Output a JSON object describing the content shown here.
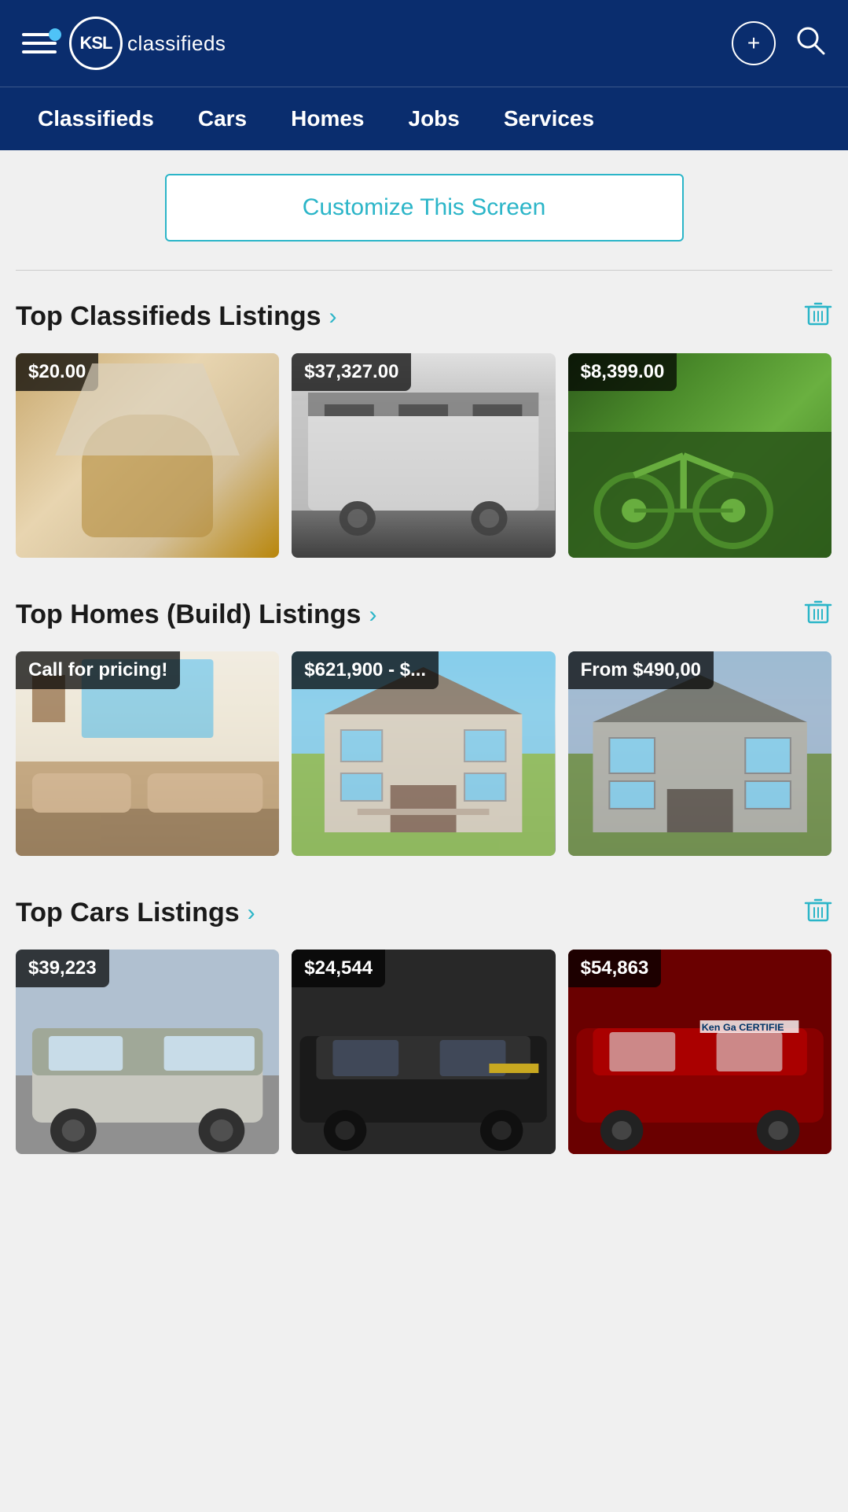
{
  "app": {
    "name": "KSL Classifieds",
    "logo_text": "KSL",
    "logo_sub": "classifieds"
  },
  "nav": {
    "items": [
      {
        "id": "classifieds",
        "label": "Classifieds"
      },
      {
        "id": "cars",
        "label": "Cars"
      },
      {
        "id": "homes",
        "label": "Homes"
      },
      {
        "id": "jobs",
        "label": "Jobs"
      },
      {
        "id": "services",
        "label": "Services"
      }
    ]
  },
  "customize_button": "Customize This Screen",
  "sections": [
    {
      "id": "top-classifieds",
      "title": "Top Classifieds Listings",
      "listings": [
        {
          "price": "$20.00",
          "img_class": "img-lamp",
          "alt": "Lamp"
        },
        {
          "price": "$37,327.00",
          "img_class": "img-trailer",
          "alt": "RV Trailer"
        },
        {
          "price": "$8,399.00",
          "img_class": "img-bikes",
          "alt": "Dirt Bikes"
        }
      ]
    },
    {
      "id": "top-homes",
      "title": "Top Homes (Build) Listings",
      "listings": [
        {
          "price": "Call for pricing!",
          "img_class": "img-living-room",
          "alt": "Living Room"
        },
        {
          "price": "$621,900 - $...",
          "img_class": "img-house1",
          "alt": "House 1"
        },
        {
          "price": "From $490,00",
          "img_class": "img-house2",
          "alt": "House 2"
        }
      ]
    },
    {
      "id": "top-cars",
      "title": "Top Cars Listings",
      "listings": [
        {
          "price": "$39,223",
          "img_class": "img-truck",
          "alt": "Truck"
        },
        {
          "price": "$24,544",
          "img_class": "img-suv",
          "alt": "SUV"
        },
        {
          "price": "$54,863",
          "img_class": "img-car-red",
          "alt": "Car"
        }
      ]
    }
  ],
  "icons": {
    "hamburger": "☰",
    "add": "+",
    "search": "🔍",
    "chevron_right": "›",
    "trash": "🗑"
  }
}
